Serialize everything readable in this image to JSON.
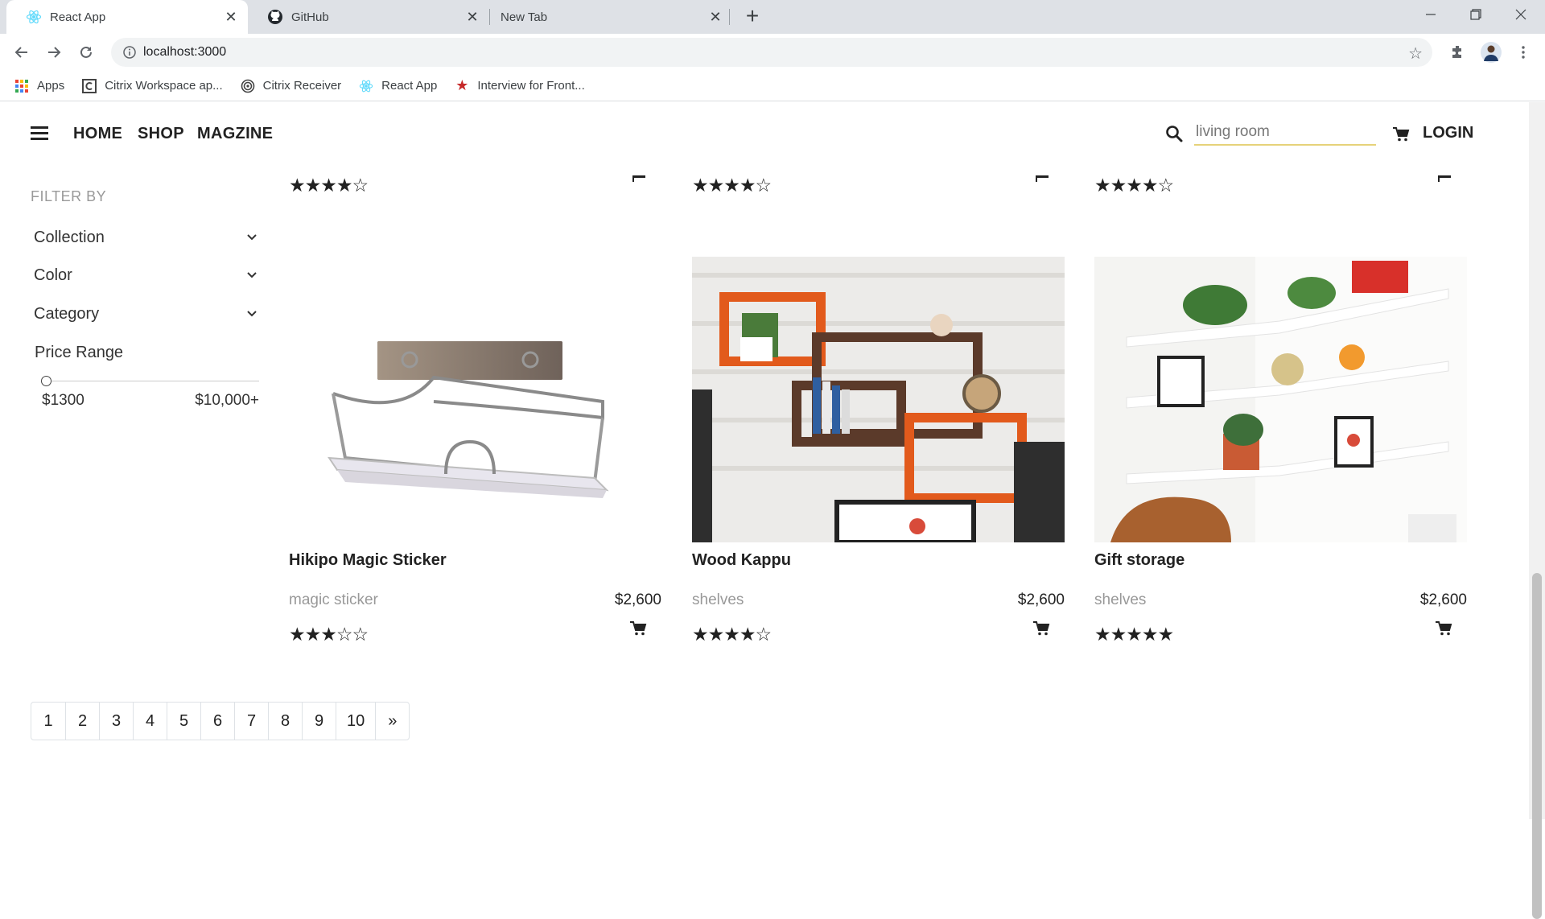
{
  "browser": {
    "tabs": [
      {
        "title": "React App",
        "icon": "react-icon",
        "active": true
      },
      {
        "title": "GitHub",
        "icon": "github-icon",
        "active": false
      },
      {
        "title": "New Tab",
        "icon": "",
        "active": false
      }
    ],
    "url": "localhost:3000",
    "bookmarks": [
      {
        "label": "Apps",
        "icon": "apps-grid-icon"
      },
      {
        "label": "Citrix Workspace ap...",
        "icon": "citrix-icon"
      },
      {
        "label": "Citrix Receiver",
        "icon": "citrix-receiver-icon"
      },
      {
        "label": "React App",
        "icon": "react-icon"
      },
      {
        "label": "Interview for Front...",
        "icon": "star-icon"
      }
    ]
  },
  "nav": {
    "links": [
      "HOME",
      "SHOP",
      "MAGZINE"
    ],
    "search_value": "living room",
    "login": "LOGIN"
  },
  "filters": {
    "title": "FILTER BY",
    "items": [
      "Collection",
      "Color",
      "Category"
    ],
    "price_label": "Price Range",
    "price_min": "$1300",
    "price_max": "$10,000+",
    "slider_value": 0
  },
  "top_row_ratings": [
    4,
    4,
    4
  ],
  "products": [
    {
      "name": "Hikipo Magic Sticker",
      "category": "magic sticker",
      "price": "$2,600",
      "rating": 3
    },
    {
      "name": "Wood Kappu",
      "category": "shelves",
      "price": "$2,600",
      "rating": 4
    },
    {
      "name": "Gift storage",
      "category": "shelves",
      "price": "$2,600",
      "rating": 5
    }
  ],
  "pagination": [
    "1",
    "2",
    "3",
    "4",
    "5",
    "6",
    "7",
    "8",
    "9",
    "10",
    "»"
  ],
  "colors": {
    "accent_underline": "#e6d27a",
    "text": "#222222",
    "muted": "#999999"
  }
}
